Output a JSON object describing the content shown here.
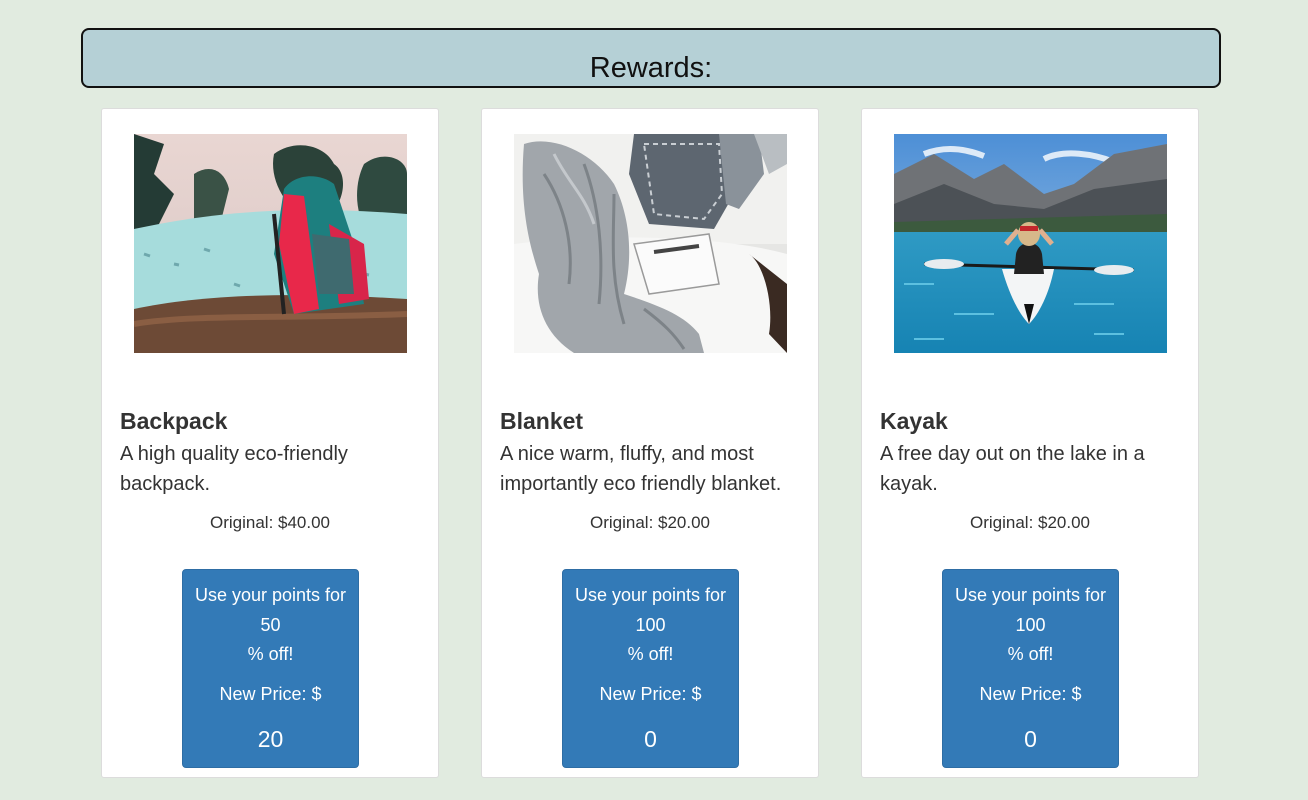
{
  "header": {
    "title": "Rewards:"
  },
  "rewards": [
    {
      "name": "Backpack",
      "description": "A high quality eco-friendly backpack.",
      "original": "Original: $40.00",
      "button": {
        "prefix": "Use your points for",
        "points": "50",
        "suffix": "% off!",
        "new_price_label": "New Price: $",
        "new_price": "20"
      },
      "image_icon": "backpack-photo"
    },
    {
      "name": "Blanket",
      "description": "A nice warm, fluffy, and most importantly eco friendly blanket.",
      "original": "Original: $20.00",
      "button": {
        "prefix": "Use your points for",
        "points": "100",
        "suffix": "% off!",
        "new_price_label": "New Price: $",
        "new_price": "0"
      },
      "image_icon": "blanket-photo"
    },
    {
      "name": "Kayak",
      "description": "A free day out on the lake in a kayak.",
      "original": "Original: $20.00",
      "button": {
        "prefix": "Use your points for",
        "points": "100",
        "suffix": "% off!",
        "new_price_label": "New Price: $",
        "new_price": "0"
      },
      "image_icon": "kayak-photo"
    }
  ],
  "colors": {
    "page_background": "#e1ebe0",
    "header_background": "#b5d0d6",
    "button_primary": "#337ab7",
    "text": "#333333"
  }
}
